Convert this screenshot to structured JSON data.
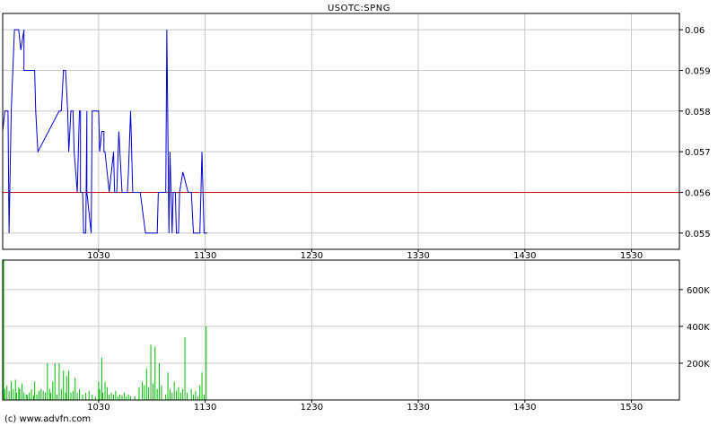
{
  "chart_data": [
    {
      "type": "line",
      "title": "USOTC:SPNG",
      "xlabel": "",
      "ylabel": "",
      "x_range": [
        940,
        1575
      ],
      "ylim": [
        0.0546,
        0.0604
      ],
      "x_ticks": [
        {
          "value": 1030,
          "label": "1030"
        },
        {
          "value": 1130,
          "label": "1130"
        },
        {
          "value": 1230,
          "label": "1230"
        },
        {
          "value": 1330,
          "label": "1330"
        },
        {
          "value": 1430,
          "label": "1430"
        },
        {
          "value": 1530,
          "label": "1530"
        }
      ],
      "y_ticks": [
        {
          "value": 0.055,
          "label": "0.055"
        },
        {
          "value": 0.056,
          "label": "0.056"
        },
        {
          "value": 0.057,
          "label": "0.057"
        },
        {
          "value": 0.058,
          "label": "0.058"
        },
        {
          "value": 0.059,
          "label": "0.059"
        },
        {
          "value": 0.06,
          "label": "0.06"
        }
      ],
      "grid": true,
      "reference_line": {
        "value": 0.056,
        "color": "#cc0000"
      },
      "series": [
        {
          "color": "#0000cc",
          "x": [
            933,
            935,
            935,
            938,
            942,
            943,
            945,
            946,
            948,
            951,
            955,
            957,
            960,
            960,
            962,
            970,
            971,
            971,
            973,
            993,
            995,
            996,
            997,
            999,
            1001,
            1002,
            1004,
            1006,
            1006,
            1007,
            1010,
            1010,
            1012,
            1013,
            1013,
            1015,
            1016,
            1018,
            1019,
            1019,
            1023,
            1024,
            1026,
            1028,
            1030,
            1031,
            1033,
            1035,
            1035,
            1036,
            1040,
            1044,
            1045,
            1047,
            1049,
            1050,
            1052,
            1054,
            1055,
            1057,
            1058,
            1060,
            1062,
            1064,
            1065,
            1069,
            1074,
            1080,
            1085,
            1086,
            1089,
            1093,
            1094,
            1096,
            1097,
            1099,
            1100,
            1102,
            1103,
            1105,
            1106,
            1109,
            1114,
            1117,
            1119,
            1123,
            1125,
            1126,
            1127,
            1129,
            1132
          ],
          "y": [
            0.058,
            0.058,
            0.056,
            0.0575,
            0.058,
            0.058,
            0.058,
            0.055,
            0.058,
            0.06,
            0.06,
            0.0595,
            0.06,
            0.059,
            0.059,
            0.059,
            0.058,
            0.058,
            0.057,
            0.058,
            0.058,
            0.0585,
            0.059,
            0.059,
            0.058,
            0.057,
            0.058,
            0.058,
            0.058,
            0.057,
            0.056,
            0.056,
            0.058,
            0.058,
            0.056,
            0.056,
            0.055,
            0.055,
            0.058,
            0.056,
            0.055,
            0.058,
            0.058,
            0.058,
            0.058,
            0.057,
            0.0575,
            0.0575,
            0.057,
            0.057,
            0.056,
            0.057,
            0.056,
            0.056,
            0.0575,
            0.057,
            0.056,
            0.056,
            0.056,
            0.056,
            0.0565,
            0.058,
            0.056,
            0.056,
            0.056,
            0.056,
            0.055,
            0.055,
            0.055,
            0.056,
            0.056,
            0.056,
            0.06,
            0.055,
            0.057,
            0.055,
            0.056,
            0.056,
            0.055,
            0.055,
            0.056,
            0.0565,
            0.056,
            0.056,
            0.055,
            0.055,
            0.055,
            0.056,
            0.057,
            0.055,
            0.055
          ]
        }
      ]
    },
    {
      "type": "bar",
      "title": "",
      "xlabel": "",
      "ylabel": "",
      "x_range": [
        940,
        1575
      ],
      "ylim": [
        0,
        760000
      ],
      "y_ticks": [
        {
          "value": 200000,
          "label": "200K"
        },
        {
          "value": 400000,
          "label": "400K"
        },
        {
          "value": 600000,
          "label": "600K"
        }
      ],
      "x_ticks": [
        {
          "value": 1030,
          "label": "1030"
        },
        {
          "value": 1130,
          "label": "1130"
        },
        {
          "value": 1230,
          "label": "1230"
        },
        {
          "value": 1330,
          "label": "1330"
        },
        {
          "value": 1430,
          "label": "1430"
        },
        {
          "value": 1530,
          "label": "1530"
        }
      ],
      "grid": true,
      "color": "#00bb00",
      "x": [
        932,
        934,
        935,
        937,
        939,
        941,
        942,
        944,
        946,
        948,
        950,
        952,
        953,
        955,
        956,
        958,
        960,
        962,
        963,
        965,
        967,
        969,
        970,
        972,
        974,
        976,
        978,
        980,
        982,
        984,
        985,
        987,
        989,
        991,
        993,
        995,
        997,
        999,
        1000,
        1002,
        1004,
        1006,
        1008,
        1010,
        1012,
        1015,
        1018,
        1021,
        1024,
        1027,
        1030,
        1031,
        1033,
        1034,
        1036,
        1038,
        1040,
        1042,
        1044,
        1046,
        1048,
        1050,
        1052,
        1054,
        1056,
        1058,
        1060,
        1064,
        1068,
        1071,
        1073,
        1075,
        1077,
        1079,
        1081,
        1083,
        1085,
        1087,
        1089,
        1093,
        1095,
        1097,
        1099,
        1101,
        1103,
        1105,
        1107,
        1109,
        1111,
        1113,
        1117,
        1119,
        1121,
        1123,
        1125,
        1127,
        1129,
        1131
      ],
      "values": [
        760000,
        60000,
        40000,
        80000,
        120000,
        30000,
        60000,
        80000,
        50000,
        100000,
        60000,
        110000,
        40000,
        70000,
        60000,
        90000,
        40000,
        30000,
        30000,
        40000,
        60000,
        25000,
        100000,
        30000,
        50000,
        60000,
        50000,
        40000,
        200000,
        60000,
        40000,
        100000,
        200000,
        30000,
        200000,
        60000,
        160000,
        40000,
        130000,
        160000,
        40000,
        50000,
        120000,
        40000,
        60000,
        30000,
        40000,
        50000,
        30000,
        20000,
        100000,
        60000,
        230000,
        40000,
        100000,
        70000,
        30000,
        40000,
        30000,
        50000,
        20000,
        30000,
        25000,
        40000,
        20000,
        30000,
        20000,
        20000,
        70000,
        100000,
        80000,
        170000,
        70000,
        300000,
        90000,
        290000,
        60000,
        200000,
        80000,
        30000,
        150000,
        60000,
        40000,
        100000,
        50000,
        70000,
        40000,
        60000,
        340000,
        40000,
        60000,
        30000,
        50000,
        20000,
        80000,
        150000,
        30000,
        400000,
        100000
      ]
    }
  ],
  "footer": {
    "credit": "(c) www.advfn.com"
  },
  "colors": {
    "grid": "#c8c8c8",
    "frame": "#000000",
    "price_line": "#0000cc",
    "reference_line": "#cc0000",
    "volume": "#00bb00"
  }
}
